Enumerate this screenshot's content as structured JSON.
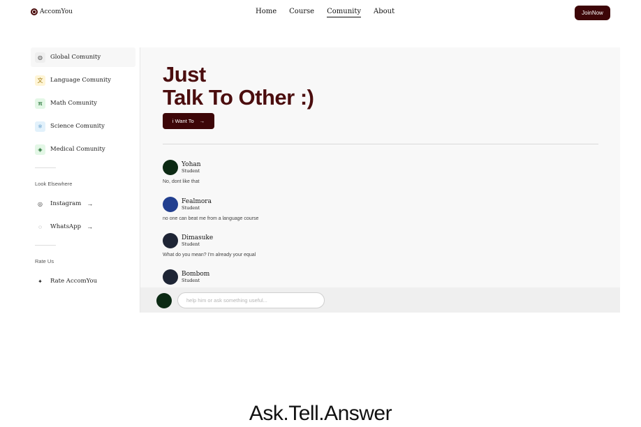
{
  "header": {
    "logo_text": "AccomYou",
    "nav": [
      {
        "label": "Home",
        "active": false
      },
      {
        "label": "Course",
        "active": false
      },
      {
        "label": "Comunity",
        "active": true
      },
      {
        "label": "About",
        "active": false
      }
    ],
    "join_label": "JoinNow"
  },
  "sidebar": {
    "items": [
      {
        "label": "Global Comunity",
        "icon": "globe-icon",
        "glyph": "◍",
        "color": "#eeeeee"
      },
      {
        "label": "Language Comunity",
        "icon": "translate-icon",
        "glyph": "文",
        "color": "#fff5d6"
      },
      {
        "label": "Math Comunity",
        "icon": "pi-icon",
        "glyph": "π",
        "color": "#e3f7e6"
      },
      {
        "label": "Science Comunity",
        "icon": "atom-icon",
        "glyph": "⚛",
        "color": "#e2f1fb"
      },
      {
        "label": "Medical Comunity",
        "icon": "medical-icon",
        "glyph": "◈",
        "color": "#e3f7e6"
      }
    ],
    "elsewhere_heading": "Look Elsewhere",
    "elsewhere": [
      {
        "label": "Instagram",
        "icon": "instagram-icon",
        "glyph": "◎"
      },
      {
        "label": "WhatsApp",
        "icon": "whatsapp-icon",
        "glyph": "◌"
      }
    ],
    "rate_heading": "Rate Us",
    "rate_label": "Rate AccomYou",
    "rate_glyph": "✦"
  },
  "main": {
    "title_line1": "Just",
    "title_line2": "Talk To Other :)",
    "cta_label": "i Want To",
    "cta_arrow": "→",
    "messages": [
      {
        "name": "Yohan",
        "role": "Student",
        "text": "No, dont like that",
        "avatar_color": "#0c2a14"
      },
      {
        "name": "Fealmora",
        "role": "Student",
        "text": "no one can beat me from a language course",
        "avatar_color": "#223f8f"
      },
      {
        "name": "Dimasuke",
        "role": "Student",
        "text": "What do you mean? I'm already your equal",
        "avatar_color": "#1e2535"
      },
      {
        "name": "Bombom",
        "role": "Student",
        "text": "",
        "avatar_color": "#1e2535"
      }
    ],
    "input_placeholder": "help him or ask something useful..."
  },
  "footer": {
    "title": "Ask.Tell.Answer"
  }
}
